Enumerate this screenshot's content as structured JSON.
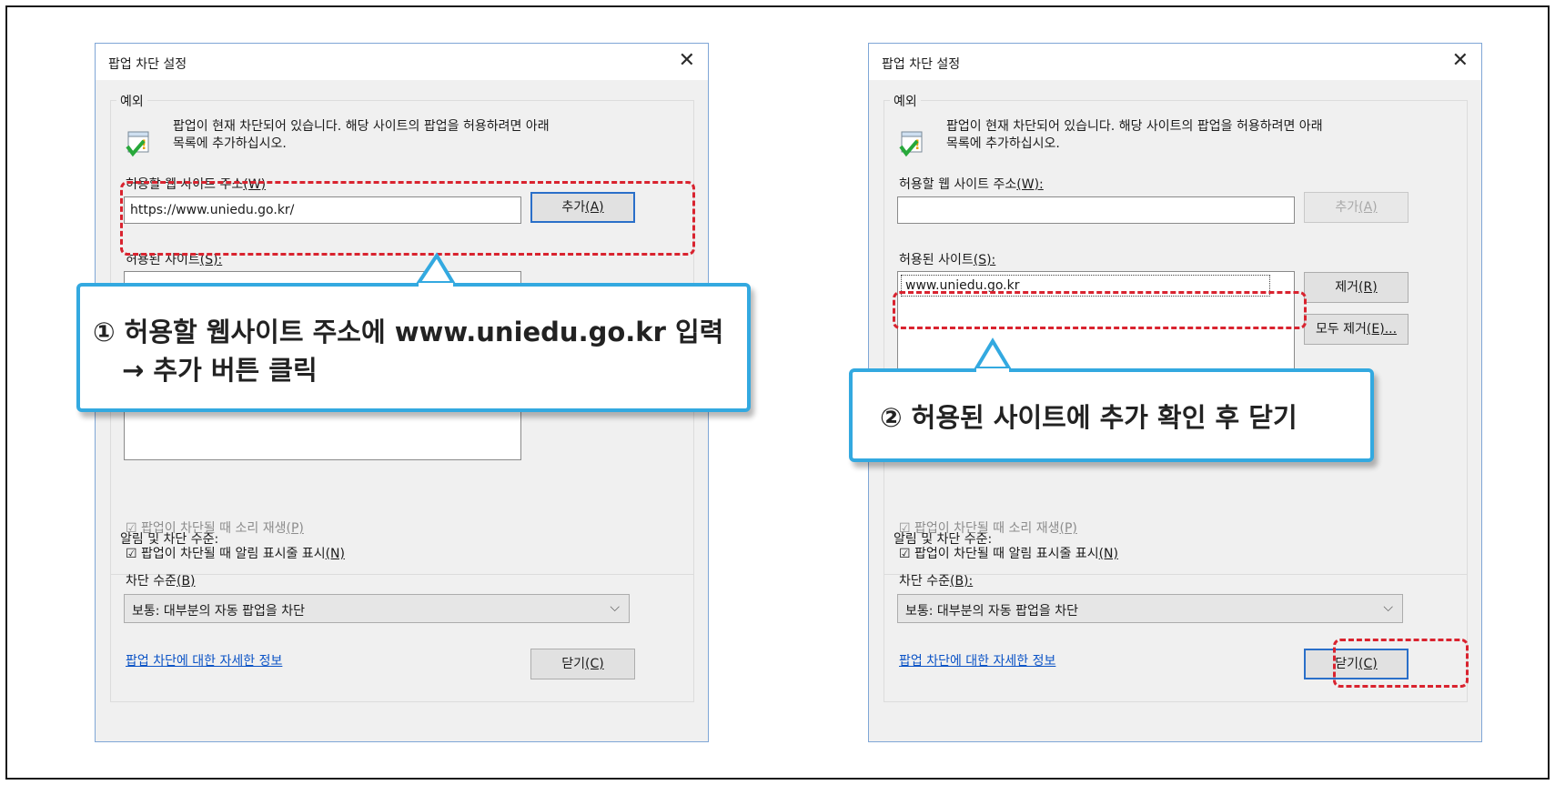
{
  "dialogs": [
    {
      "title": "팝업 차단 설정",
      "close_glyph": "✕",
      "exceptions_legend": "예외",
      "info_icon": "info-check-icon",
      "info_line1": "팝업이 현재 차단되어 있습니다. 해당 사이트의 팝업을 허용하려면 아래",
      "info_line2": "목록에 추가하십시오.",
      "address_label": "허용할 웹 사이트 주소",
      "address_key": "(W)",
      "address_value": "https://www.uniedu.go.kr/",
      "add_label": "추가",
      "add_key": "(A)",
      "allowed_label": "허용된 사이트",
      "allowed_key": "(S):",
      "allowed_items": [],
      "notify_legend": "알림 및 차단 수준:",
      "sound_label": "☑ 팝업이 차단될 때 소리 재생",
      "sound_key": "(P)",
      "bar_label": "☑ 팝업이 차단될 때 알림 표시줄 표시",
      "bar_key": "(N)",
      "level_label": "차단 수준",
      "level_key": "(B)",
      "level_value": "보통: 대부분의 자동 팝업을 차단",
      "more_info_link": "팝업 차단에 대한 자세한 정보",
      "close_label": "닫기",
      "close_key": "(C)"
    },
    {
      "title": "팝업 차단 설정",
      "close_glyph": "✕",
      "exceptions_legend": "예외",
      "info_icon": "info-check-icon",
      "info_line1": "팝업이 현재 차단되어 있습니다. 해당 사이트의 팝업을 허용하려면 아래",
      "info_line2": "목록에 추가하십시오.",
      "address_label": "허용할 웹 사이트 주소",
      "address_key": "(W):",
      "address_value": "",
      "add_label": "추가",
      "add_key": "(A)",
      "allowed_label": "허용된 사이트",
      "allowed_key": "(S):",
      "allowed_items": [
        "www.uniedu.go.kr"
      ],
      "remove_label": "제거",
      "remove_key": "(R)",
      "remove_all_label": "모두 제거",
      "remove_all_key": "(E)...",
      "notify_legend": "알림 및 차단 수준:",
      "sound_label": "☑ 팝업이 차단될 때 소리 재생",
      "sound_key": "(P)",
      "bar_label": "☑ 팝업이 차단될 때 알림 표시줄 표시",
      "bar_key": "(N)",
      "level_label": "차단 수준",
      "level_key": "(B):",
      "level_value": "보통: 대부분의 자동 팝업을 차단",
      "more_info_link": "팝업 차단에 대한 자세한 정보",
      "close_label": "닫기",
      "close_key": "(C)"
    }
  ],
  "callouts": {
    "step1_line1": "① 허용할 웹사이트 주소에 www.uniedu.go.kr 입력",
    "step1_line2": "→ 추가 버튼 클릭",
    "step2": "② 허용된 사이트에 추가 확인 후 닫기"
  },
  "colors": {
    "highlight": "#d9232f",
    "callout_border": "#33a9e0",
    "link": "#0b53c6"
  }
}
